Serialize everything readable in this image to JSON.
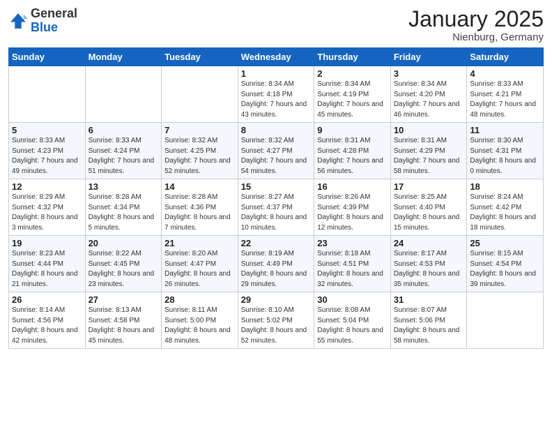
{
  "header": {
    "logo_general": "General",
    "logo_blue": "Blue",
    "month_title": "January 2025",
    "subtitle": "Nienburg, Germany"
  },
  "weekdays": [
    "Sunday",
    "Monday",
    "Tuesday",
    "Wednesday",
    "Thursday",
    "Friday",
    "Saturday"
  ],
  "weeks": [
    [
      {
        "day": "",
        "info": ""
      },
      {
        "day": "",
        "info": ""
      },
      {
        "day": "",
        "info": ""
      },
      {
        "day": "1",
        "info": "Sunrise: 8:34 AM\nSunset: 4:18 PM\nDaylight: 7 hours\nand 43 minutes."
      },
      {
        "day": "2",
        "info": "Sunrise: 8:34 AM\nSunset: 4:19 PM\nDaylight: 7 hours\nand 45 minutes."
      },
      {
        "day": "3",
        "info": "Sunrise: 8:34 AM\nSunset: 4:20 PM\nDaylight: 7 hours\nand 46 minutes."
      },
      {
        "day": "4",
        "info": "Sunrise: 8:33 AM\nSunset: 4:21 PM\nDaylight: 7 hours\nand 48 minutes."
      }
    ],
    [
      {
        "day": "5",
        "info": "Sunrise: 8:33 AM\nSunset: 4:23 PM\nDaylight: 7 hours\nand 49 minutes."
      },
      {
        "day": "6",
        "info": "Sunrise: 8:33 AM\nSunset: 4:24 PM\nDaylight: 7 hours\nand 51 minutes."
      },
      {
        "day": "7",
        "info": "Sunrise: 8:32 AM\nSunset: 4:25 PM\nDaylight: 7 hours\nand 52 minutes."
      },
      {
        "day": "8",
        "info": "Sunrise: 8:32 AM\nSunset: 4:27 PM\nDaylight: 7 hours\nand 54 minutes."
      },
      {
        "day": "9",
        "info": "Sunrise: 8:31 AM\nSunset: 4:28 PM\nDaylight: 7 hours\nand 56 minutes."
      },
      {
        "day": "10",
        "info": "Sunrise: 8:31 AM\nSunset: 4:29 PM\nDaylight: 7 hours\nand 58 minutes."
      },
      {
        "day": "11",
        "info": "Sunrise: 8:30 AM\nSunset: 4:31 PM\nDaylight: 8 hours\nand 0 minutes."
      }
    ],
    [
      {
        "day": "12",
        "info": "Sunrise: 8:29 AM\nSunset: 4:32 PM\nDaylight: 8 hours\nand 3 minutes."
      },
      {
        "day": "13",
        "info": "Sunrise: 8:28 AM\nSunset: 4:34 PM\nDaylight: 8 hours\nand 5 minutes."
      },
      {
        "day": "14",
        "info": "Sunrise: 8:28 AM\nSunset: 4:36 PM\nDaylight: 8 hours\nand 7 minutes."
      },
      {
        "day": "15",
        "info": "Sunrise: 8:27 AM\nSunset: 4:37 PM\nDaylight: 8 hours\nand 10 minutes."
      },
      {
        "day": "16",
        "info": "Sunrise: 8:26 AM\nSunset: 4:39 PM\nDaylight: 8 hours\nand 12 minutes."
      },
      {
        "day": "17",
        "info": "Sunrise: 8:25 AM\nSunset: 4:40 PM\nDaylight: 8 hours\nand 15 minutes."
      },
      {
        "day": "18",
        "info": "Sunrise: 8:24 AM\nSunset: 4:42 PM\nDaylight: 8 hours\nand 18 minutes."
      }
    ],
    [
      {
        "day": "19",
        "info": "Sunrise: 8:23 AM\nSunset: 4:44 PM\nDaylight: 8 hours\nand 21 minutes."
      },
      {
        "day": "20",
        "info": "Sunrise: 8:22 AM\nSunset: 4:45 PM\nDaylight: 8 hours\nand 23 minutes."
      },
      {
        "day": "21",
        "info": "Sunrise: 8:20 AM\nSunset: 4:47 PM\nDaylight: 8 hours\nand 26 minutes."
      },
      {
        "day": "22",
        "info": "Sunrise: 8:19 AM\nSunset: 4:49 PM\nDaylight: 8 hours\nand 29 minutes."
      },
      {
        "day": "23",
        "info": "Sunrise: 8:18 AM\nSunset: 4:51 PM\nDaylight: 8 hours\nand 32 minutes."
      },
      {
        "day": "24",
        "info": "Sunrise: 8:17 AM\nSunset: 4:53 PM\nDaylight: 8 hours\nand 35 minutes."
      },
      {
        "day": "25",
        "info": "Sunrise: 8:15 AM\nSunset: 4:54 PM\nDaylight: 8 hours\nand 39 minutes."
      }
    ],
    [
      {
        "day": "26",
        "info": "Sunrise: 8:14 AM\nSunset: 4:56 PM\nDaylight: 8 hours\nand 42 minutes."
      },
      {
        "day": "27",
        "info": "Sunrise: 8:13 AM\nSunset: 4:58 PM\nDaylight: 8 hours\nand 45 minutes."
      },
      {
        "day": "28",
        "info": "Sunrise: 8:11 AM\nSunset: 5:00 PM\nDaylight: 8 hours\nand 48 minutes."
      },
      {
        "day": "29",
        "info": "Sunrise: 8:10 AM\nSunset: 5:02 PM\nDaylight: 8 hours\nand 52 minutes."
      },
      {
        "day": "30",
        "info": "Sunrise: 8:08 AM\nSunset: 5:04 PM\nDaylight: 8 hours\nand 55 minutes."
      },
      {
        "day": "31",
        "info": "Sunrise: 8:07 AM\nSunset: 5:06 PM\nDaylight: 8 hours\nand 58 minutes."
      },
      {
        "day": "",
        "info": ""
      }
    ]
  ]
}
